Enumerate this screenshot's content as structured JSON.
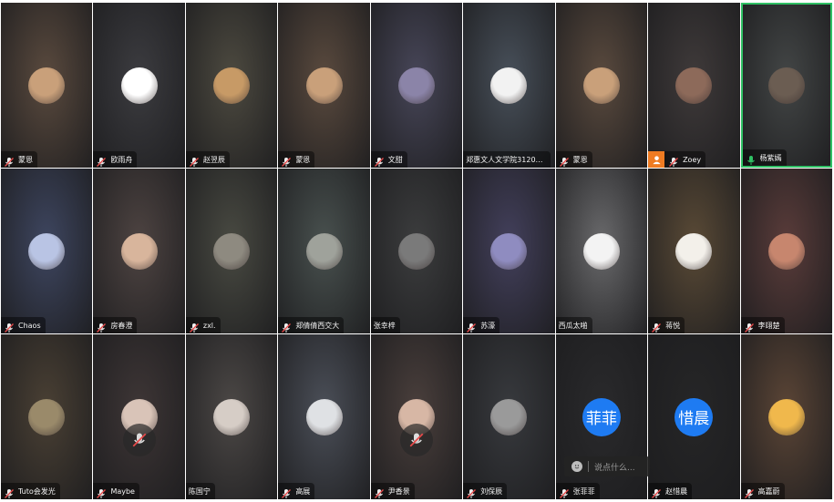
{
  "colors": {
    "active_border": "#2fc064",
    "text_avatar": "#1e7bf2",
    "host_badge": "#ef7b22"
  },
  "chat": {
    "placeholder": "说点什么..."
  },
  "tiles": [
    {
      "name": "蒙恩",
      "mic": "muted",
      "bg": "#5a4a3e",
      "av": "#c9a07a"
    },
    {
      "name": "欧雨舟",
      "mic": "muted",
      "bg": "#3c3c40",
      "av": "#ffffff"
    },
    {
      "name": "赵翌辰",
      "mic": "muted",
      "bg": "#4d4a40",
      "av": "#c79a66"
    },
    {
      "name": "蒙恩",
      "mic": "muted",
      "bg": "#5a4a3e",
      "av": "#c9a07a"
    },
    {
      "name": "文甜",
      "mic": "muted",
      "bg": "#474658",
      "av": "#8b84a8"
    },
    {
      "name": "郑惠文人文学院312031...",
      "mic": "none",
      "bg": "#48505a",
      "av": "#f2f2f2"
    },
    {
      "name": "蒙恩",
      "mic": "muted",
      "bg": "#5a4a3e",
      "av": "#c9a07a"
    },
    {
      "name": "Zoey",
      "mic": "muted",
      "host": true,
      "bg": "#3f3a3a",
      "av": "#8d6a5a"
    },
    {
      "name": "杨紫嫣",
      "mic": "speaking",
      "active": true,
      "bg": "#434646",
      "av": "#6b5d52"
    },
    {
      "name": "Chaos",
      "mic": "muted",
      "bg": "#3e4660",
      "av": "#b9c4e4"
    },
    {
      "name": "房春澄",
      "mic": "muted",
      "bg": "#4e4442",
      "av": "#d8b59c"
    },
    {
      "name": "zxl.",
      "mic": "muted",
      "bg": "#494a42",
      "av": "#8e8a80"
    },
    {
      "name": "郑倩倩西交大",
      "mic": "muted",
      "bg": "#49514f",
      "av": "#9fa29b"
    },
    {
      "name": "张幸梓",
      "mic": "none",
      "bg": "#3c3d3e",
      "av": "#7a7a7a"
    },
    {
      "name": "苏濠",
      "mic": "muted",
      "bg": "#43405c",
      "av": "#8f8cc0"
    },
    {
      "name": "西瓜太啪",
      "mic": "none",
      "bg": "#6a6a6c",
      "av": "#f3f3f3"
    },
    {
      "name": "蒋悦",
      "mic": "muted",
      "bg": "#5a4a36",
      "av": "#f3f0ea"
    },
    {
      "name": "李翊楚",
      "mic": "muted",
      "bg": "#5a3c3a",
      "av": "#c7866e"
    },
    {
      "name": "Tuto会发光",
      "mic": "muted",
      "bg": "#4a4034",
      "av": "#9a8a6a"
    },
    {
      "name": "Maybe",
      "mic": "muted",
      "muted_overlay": true,
      "bg": "#3e3636",
      "av": "#d9c4b8"
    },
    {
      "name": "陈国宁",
      "mic": "none",
      "bg": "#4c4846",
      "av": "#d6cdc6"
    },
    {
      "name": "高展",
      "mic": "muted",
      "bg": "#4b4f58",
      "av": "#dfe1e4"
    },
    {
      "name": "尹香景",
      "mic": "muted",
      "muted_overlay": true,
      "bg": "#4a3f3c",
      "av": "#d7b7a5"
    },
    {
      "name": "刘保辰",
      "mic": "muted",
      "bg": "#383a3e",
      "av": "#9a9a9a"
    },
    {
      "name": "张菲菲",
      "mic": "muted",
      "text_avatar": "菲菲",
      "bg": "#2a2a2c"
    },
    {
      "name": "赵惜晨",
      "mic": "muted",
      "text_avatar": "惜晨",
      "bg": "#262627"
    },
    {
      "name": "高嘉蔚",
      "mic": "muted",
      "bg": "#5b4536",
      "av": "#f0b84c"
    }
  ]
}
